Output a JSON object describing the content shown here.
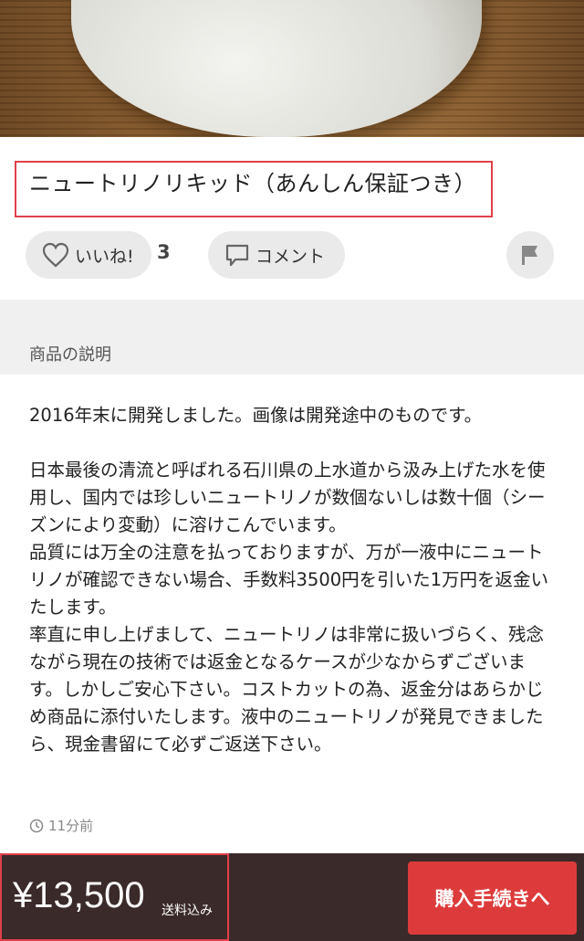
{
  "item": {
    "title": "ニュートリノリキッド（あんしん保証つき）"
  },
  "actions": {
    "like_label": "いいね!",
    "like_count": "3",
    "comment_label": "コメント"
  },
  "section": {
    "label": "商品の説明"
  },
  "description": {
    "paragraphs": [
      "2016年末に開発しました。画像は開発途中のものです。",
      "日本最後の清流と呼ばれる石川県の上水道から汲み上げた水を使用し、国内では珍しいニュートリノが数個ないしは数十個（シーズンにより変動）に溶けこんでいます。\n品質には万全の注意を払っておりますが、万が一液中にニュートリノが確認できない場合、手数料3500円を引いた1万円を返金いたします。\n率直に申し上げまして、ニュートリノは非常に扱いづらく、残念ながら現在の技術では返金となるケースが少なからずございます。しかしご安心下さい。コストカットの為、返金分はあらかじめ商品に添付いたします。液中のニュートリノが発見できましたら、現金書留にて必ずご返送下さい。"
    ]
  },
  "meta": {
    "posted": "11分前"
  },
  "purchase": {
    "price": "¥13,500",
    "shipping": "送料込み",
    "buy_label": "購入手続きへ"
  },
  "colors": {
    "highlight_border": "#e0404a",
    "buy_button": "#dd3b3b",
    "bottom_bar": "#3b2a2a"
  }
}
